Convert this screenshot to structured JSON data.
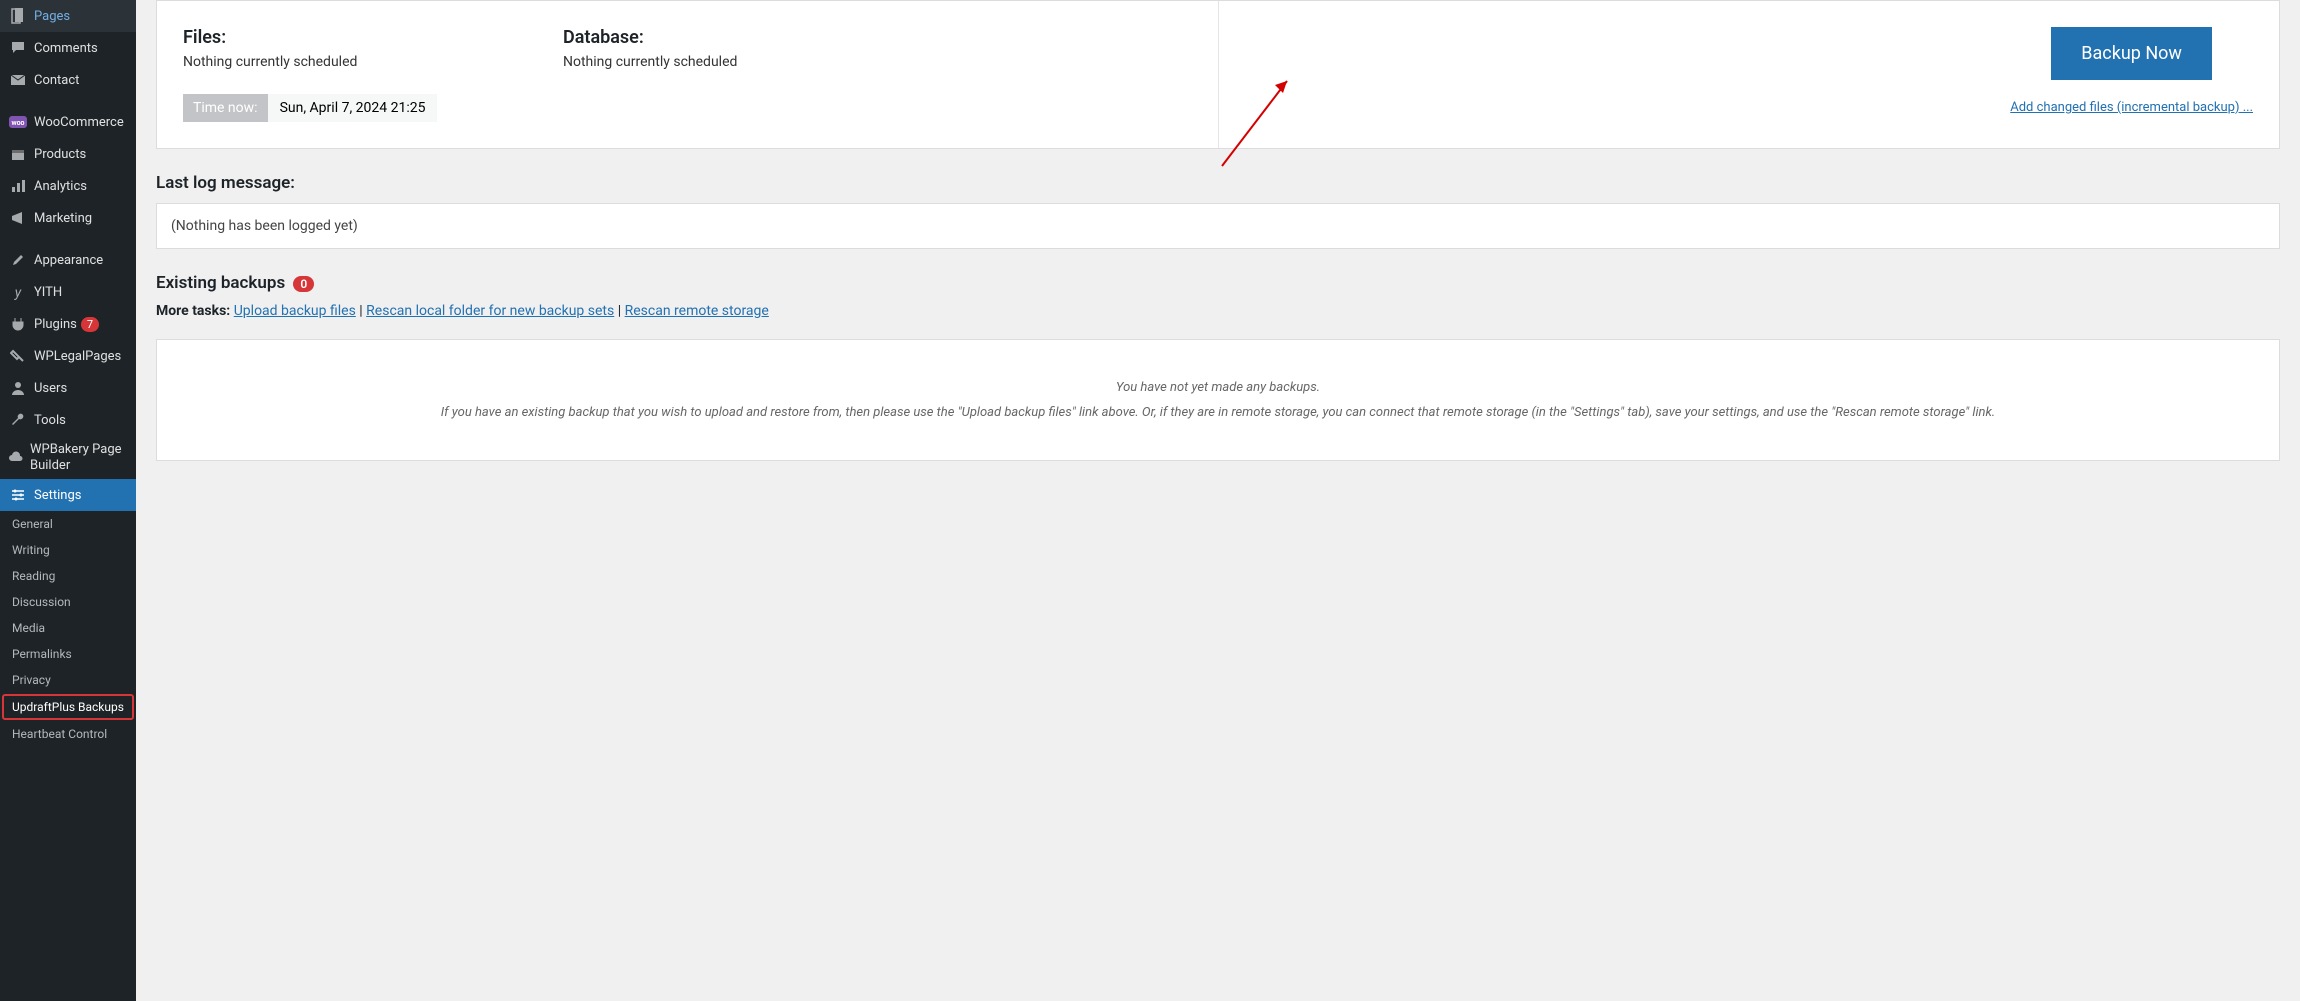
{
  "sidebar": {
    "items": [
      {
        "label": "Pages"
      },
      {
        "label": "Comments"
      },
      {
        "label": "Contact"
      },
      {
        "label": "WooCommerce"
      },
      {
        "label": "Products"
      },
      {
        "label": "Analytics"
      },
      {
        "label": "Marketing"
      },
      {
        "label": "Appearance"
      },
      {
        "label": "YITH"
      },
      {
        "label": "Plugins",
        "badge": "7"
      },
      {
        "label": "WPLegalPages"
      },
      {
        "label": "Users"
      },
      {
        "label": "Tools"
      },
      {
        "label": "WPBakery Page Builder"
      },
      {
        "label": "Settings"
      }
    ],
    "sub": [
      {
        "label": "General"
      },
      {
        "label": "Writing"
      },
      {
        "label": "Reading"
      },
      {
        "label": "Discussion"
      },
      {
        "label": "Media"
      },
      {
        "label": "Permalinks"
      },
      {
        "label": "Privacy"
      },
      {
        "label": "UpdraftPlus Backups",
        "highlight": true
      },
      {
        "label": "Heartbeat Control"
      }
    ]
  },
  "panel": {
    "files_heading": "Files:",
    "files_status": "Nothing currently scheduled",
    "db_heading": "Database:",
    "db_status": "Nothing currently scheduled",
    "time_label": "Time now:",
    "time_value": "Sun, April 7, 2024 21:25",
    "backup_btn": "Backup Now",
    "incremental_link": "Add changed files (incremental backup) ..."
  },
  "log": {
    "heading": "Last log message:",
    "body": "(Nothing has been logged yet)"
  },
  "existing": {
    "heading": "Existing backups",
    "count": "0",
    "tasks_label": "More tasks:",
    "task_upload": "Upload backup files",
    "task_rescan_local": "Rescan local folder for new backup sets",
    "task_rescan_remote": "Rescan remote storage"
  },
  "empty": {
    "line1": "You have not yet made any backups.",
    "line2": "If you have an existing backup that you wish to upload and restore from, then please use the \"Upload backup files\" link above. Or, if they are in remote storage, you can connect that remote storage (in the \"Settings\" tab), save your settings, and use the \"Rescan remote storage\" link."
  }
}
